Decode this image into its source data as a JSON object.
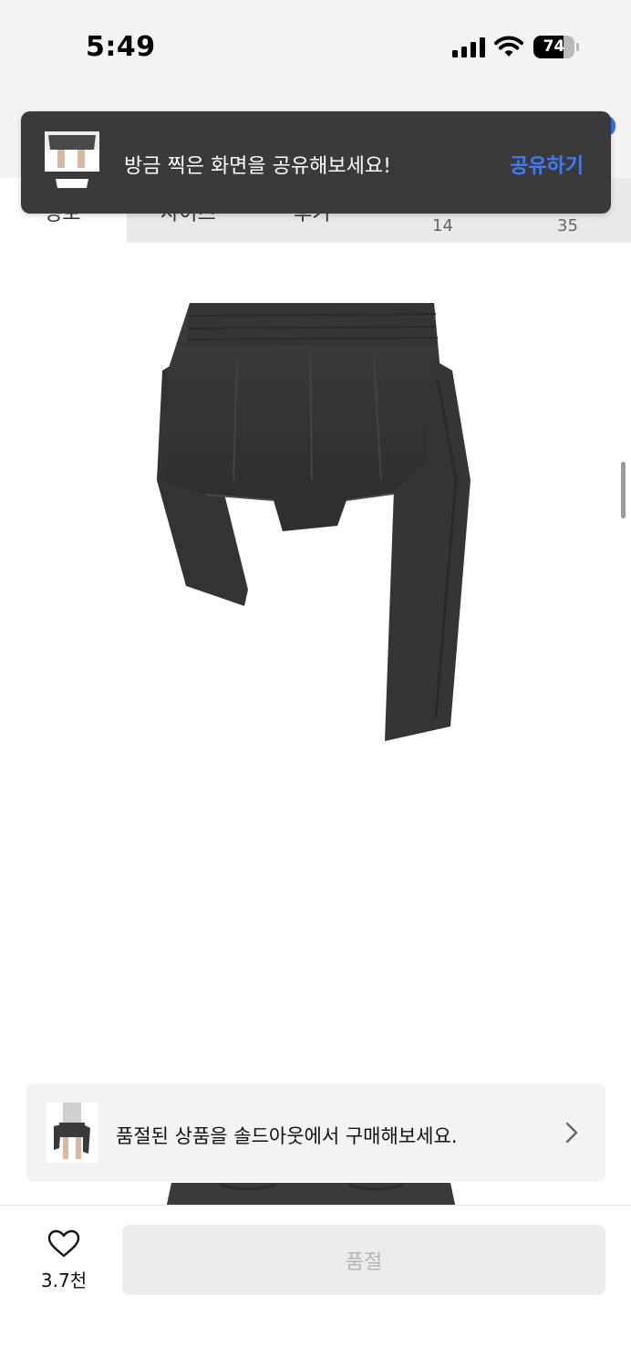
{
  "status_bar": {
    "time": "5:49",
    "battery_percent": "74",
    "battery_level": 0.74
  },
  "tabs": {
    "items": [
      {
        "label": "정보"
      },
      {
        "label": "사이즈"
      },
      {
        "label": "후기",
        "count": "14"
      },
      {
        "label": "",
        "count": "35"
      }
    ]
  },
  "toast": {
    "message": "방금 찍은 화면을 공유해보세요!",
    "action_label": "공유하기",
    "action_color": "#3f7bff"
  },
  "banner": {
    "message": "품절된 상품을 솔드아웃에서 구매해보세요."
  },
  "bottom_bar": {
    "like_count": "3.7천",
    "buy_button_label": "품절"
  },
  "icons": [
    "signal-icon",
    "wifi-icon",
    "battery-icon",
    "chevron-right-icon",
    "heart-icon"
  ]
}
